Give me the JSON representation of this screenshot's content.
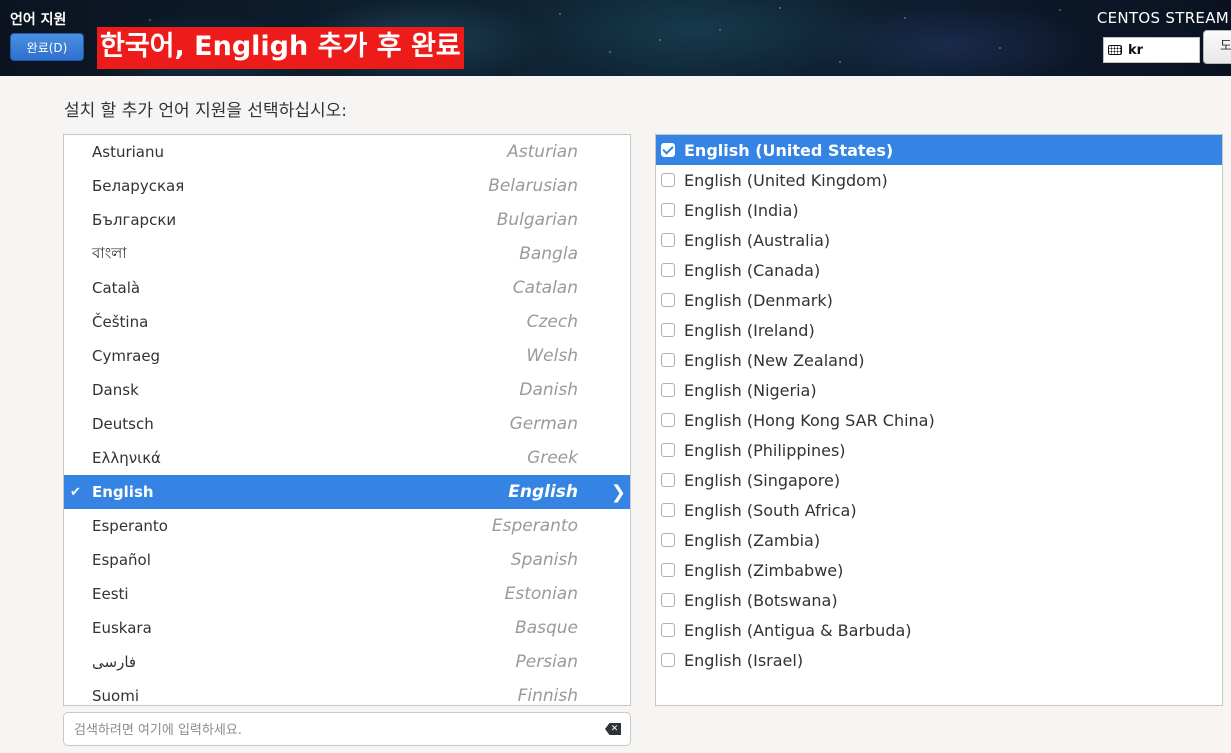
{
  "header": {
    "title": "언어 지원",
    "done_label": "완료(D)",
    "overlay_text": "한국어, Engligh 추가 후 완료",
    "product": "CENTOS STREAM",
    "keyboard_layout": "kr",
    "help_label": "도움말"
  },
  "prompt": "설치 할 추가 언어 지원을 선택하십시오:",
  "languages": [
    {
      "native": "Asturianu",
      "english": "Asturian",
      "selected": false
    },
    {
      "native": "Беларуская",
      "english": "Belarusian",
      "selected": false
    },
    {
      "native": "Български",
      "english": "Bulgarian",
      "selected": false
    },
    {
      "native": "বাংলা",
      "english": "Bangla",
      "selected": false
    },
    {
      "native": "Català",
      "english": "Catalan",
      "selected": false
    },
    {
      "native": "Čeština",
      "english": "Czech",
      "selected": false
    },
    {
      "native": "Cymraeg",
      "english": "Welsh",
      "selected": false
    },
    {
      "native": "Dansk",
      "english": "Danish",
      "selected": false
    },
    {
      "native": "Deutsch",
      "english": "German",
      "selected": false
    },
    {
      "native": "Ελληνικά",
      "english": "Greek",
      "selected": false
    },
    {
      "native": "English",
      "english": "English",
      "selected": true,
      "checked": true
    },
    {
      "native": "Esperanto",
      "english": "Esperanto",
      "selected": false
    },
    {
      "native": "Español",
      "english": "Spanish",
      "selected": false
    },
    {
      "native": "Eesti",
      "english": "Estonian",
      "selected": false
    },
    {
      "native": "Euskara",
      "english": "Basque",
      "selected": false
    },
    {
      "native": "فارسی",
      "english": "Persian",
      "selected": false
    },
    {
      "native": "Suomi",
      "english": "Finnish",
      "selected": false
    }
  ],
  "locales": [
    {
      "label": "English (United States)",
      "checked": true,
      "selected": true
    },
    {
      "label": "English (United Kingdom)",
      "checked": false,
      "selected": false
    },
    {
      "label": "English (India)",
      "checked": false,
      "selected": false
    },
    {
      "label": "English (Australia)",
      "checked": false,
      "selected": false
    },
    {
      "label": "English (Canada)",
      "checked": false,
      "selected": false
    },
    {
      "label": "English (Denmark)",
      "checked": false,
      "selected": false
    },
    {
      "label": "English (Ireland)",
      "checked": false,
      "selected": false
    },
    {
      "label": "English (New Zealand)",
      "checked": false,
      "selected": false
    },
    {
      "label": "English (Nigeria)",
      "checked": false,
      "selected": false
    },
    {
      "label": "English (Hong Kong SAR China)",
      "checked": false,
      "selected": false
    },
    {
      "label": "English (Philippines)",
      "checked": false,
      "selected": false
    },
    {
      "label": "English (Singapore)",
      "checked": false,
      "selected": false
    },
    {
      "label": "English (South Africa)",
      "checked": false,
      "selected": false
    },
    {
      "label": "English (Zambia)",
      "checked": false,
      "selected": false
    },
    {
      "label": "English (Zimbabwe)",
      "checked": false,
      "selected": false
    },
    {
      "label": "English (Botswana)",
      "checked": false,
      "selected": false
    },
    {
      "label": "English (Antigua & Barbuda)",
      "checked": false,
      "selected": false
    },
    {
      "label": "English (Israel)",
      "checked": false,
      "selected": false
    }
  ],
  "search": {
    "value": "",
    "placeholder": "검색하려면 여기에 입력하세요."
  },
  "icons": {
    "keyboard": "keyboard-icon",
    "check": "checkmark-icon",
    "arrow": "chevron-right-icon",
    "clear": "clear-backspace-icon"
  },
  "colors": {
    "selection": "#3584e4",
    "banner": "#ee1b1b",
    "done_button": "#3a7fd8"
  }
}
